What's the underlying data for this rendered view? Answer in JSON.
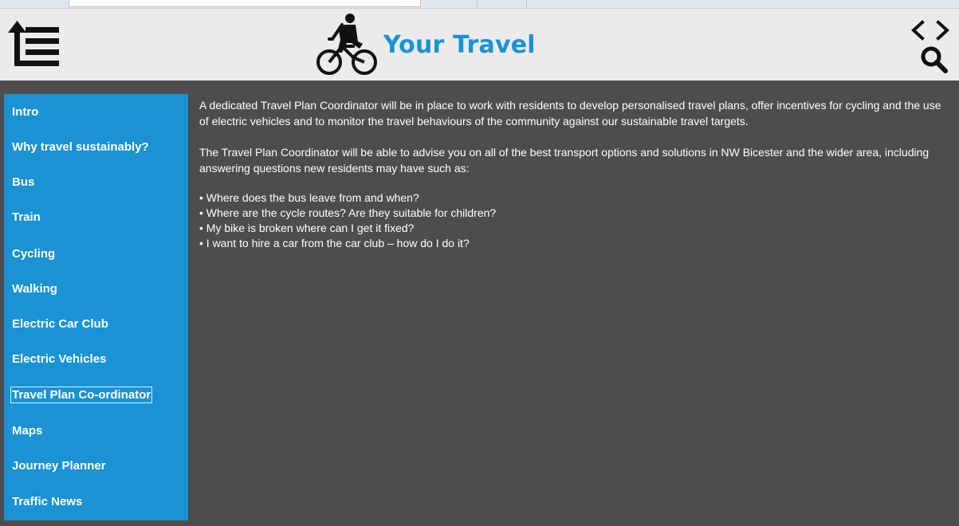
{
  "header": {
    "title": "Your Travel"
  },
  "sidebar": {
    "items": [
      {
        "label": "Intro",
        "active": false
      },
      {
        "label": "Why travel sustainably?",
        "active": false
      },
      {
        "label": "Bus",
        "active": false
      },
      {
        "label": "Train",
        "active": false
      },
      {
        "label": "Cycling",
        "active": false
      },
      {
        "label": "Walking",
        "active": false
      },
      {
        "label": "Electric Car Club",
        "active": false
      },
      {
        "label": "Electric Vehicles",
        "active": false
      },
      {
        "label": "Travel Plan Co-ordinator",
        "active": true
      },
      {
        "label": "Maps",
        "active": false
      },
      {
        "label": "Journey Planner",
        "active": false
      },
      {
        "label": "Traffic News",
        "active": false
      }
    ]
  },
  "content": {
    "paragraphs": [
      "A dedicated Travel Plan Coordinator will be in place to work with residents to develop personalised travel plans, offer incentives for cycling and the use of electric vehicles and to monitor the travel behaviours of the community against our sustainable travel targets.",
      "The Travel Plan Coordinator will be able to advise you on all of the best transport options and solutions in NW Bicester and the wider area, including answering questions new residents may have such as:"
    ],
    "questions": [
      "• Where does the bus leave from and when?",
      "• Where are the cycle routes? Are they suitable for children?",
      "• My bike is broken where can I get it fixed?",
      "• I want to hire a car from the car club – how do I do it?"
    ]
  },
  "icons": {
    "menu": "menu-toggle-icon",
    "logo": "bicycle-rider-icon",
    "prev": "chevron-left-icon",
    "next": "chevron-right-icon",
    "search": "search-icon"
  },
  "colors": {
    "accent": "#1a92d4",
    "background": "#4d4d4d",
    "header": "#ebebeb"
  }
}
